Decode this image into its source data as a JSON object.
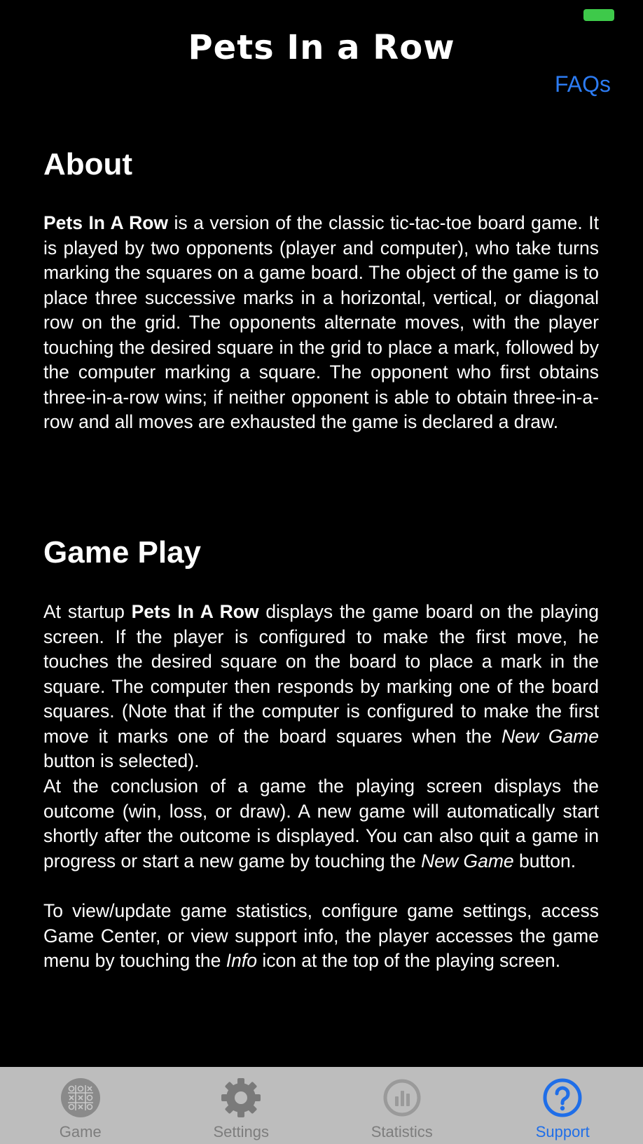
{
  "header": {
    "title": "Pets In a Row",
    "faqs_label": "FAQs"
  },
  "about": {
    "heading": "About",
    "p1_bold": "Pets In A Row",
    "p1_rest": " is a version of the classic tic-tac-toe board game. It is played by two opponents (player and computer), who take turns marking the squares on a game board. The object of the game is to place three successive marks in a horizontal, vertical, or diagonal row on the grid. The opponents alternate moves, with the player touching the desired square in the grid to place a mark, followed by the computer marking a square. The opponent who first obtains three-in-a-row wins; if neither opponent is able to obtain three-in-a-row and all moves are exhausted the game is declared a draw."
  },
  "gameplay": {
    "heading": "Game Play",
    "p1_a": "At startup ",
    "p1_bold": "Pets In A Row",
    "p1_b": " displays the game board on the playing screen. If the player is configured to make the first move, he touches the desired square on the board to place a mark in the square. The computer then responds by marking one of the board squares. (Note that if the computer is configured to make the first move it marks one of the board squares when the ",
    "p1_italic": "New Game",
    "p1_c": " button is selected).",
    "p2_a": "At the conclusion of a game the playing screen displays the outcome (win, loss, or draw). A new game will automatically start shortly after the outcome is displayed. You can also quit a game in progress or start a new game by touching the ",
    "p2_italic": "New Game",
    "p2_b": " button.",
    "p3_a": "To view/update game statistics, configure game settings, access Game Center, or view support info, the player accesses the game menu by touching the ",
    "p3_italic": "Info",
    "p3_b": " icon at the top of the playing screen."
  },
  "tabbar": {
    "tabs": [
      {
        "label": "Game",
        "icon": "tic-tac-toe-icon"
      },
      {
        "label": "Settings",
        "icon": "gear-icon"
      },
      {
        "label": "Statistics",
        "icon": "bar-chart-icon"
      },
      {
        "label": "Support",
        "icon": "question-icon"
      }
    ],
    "active_index": 3
  },
  "colors": {
    "background": "#000000",
    "accent": "#2c7bf2",
    "tabbar_bg": "#bdbdbd",
    "battery": "#3ec94a"
  }
}
